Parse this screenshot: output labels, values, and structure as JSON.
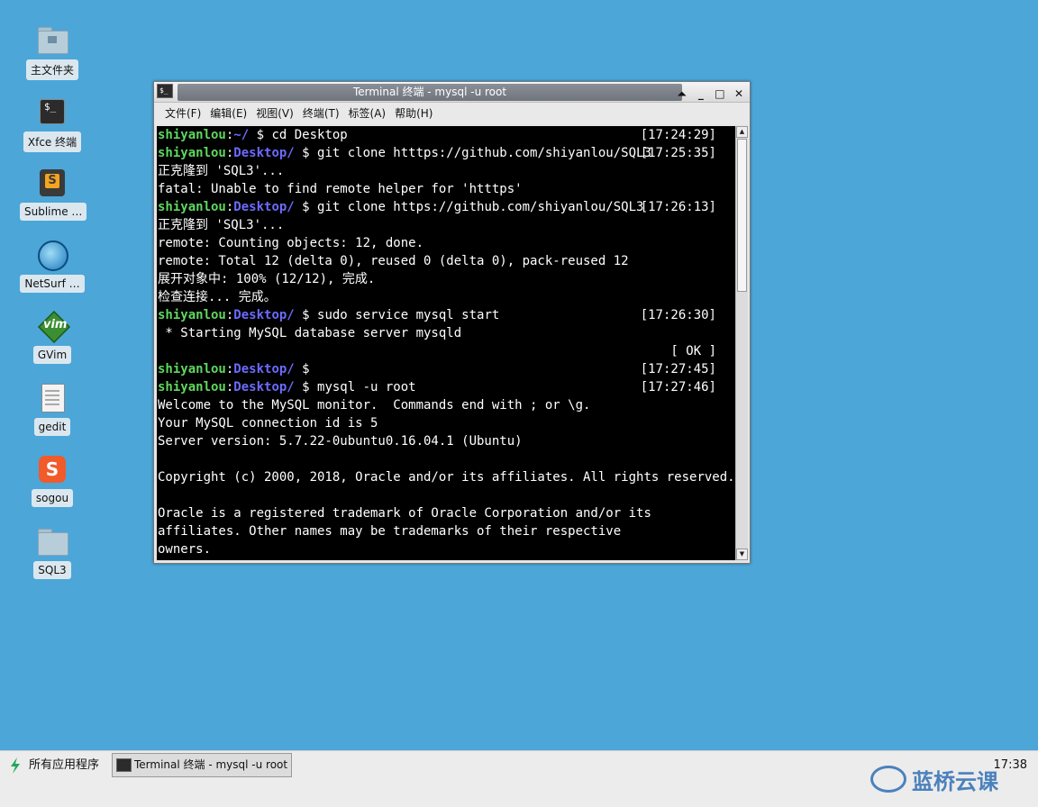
{
  "desktop": {
    "icons": [
      {
        "label": "主文件夹",
        "icon": "home-folder-icon"
      },
      {
        "label": "Xfce 终端",
        "icon": "terminal-icon"
      },
      {
        "label": "Sublime …",
        "icon": "sublime-icon"
      },
      {
        "label": "NetSurf …",
        "icon": "netsurf-icon"
      },
      {
        "label": "GVim",
        "icon": "gvim-icon"
      },
      {
        "label": "gedit",
        "icon": "gedit-icon"
      },
      {
        "label": "sogou",
        "icon": "sogou-icon"
      },
      {
        "label": "SQL3",
        "icon": "folder-icon"
      }
    ]
  },
  "window": {
    "title": "Terminal 终端 - mysql -u root",
    "buttons": {
      "shade": "⏶",
      "minimize": "_",
      "maximize": "□",
      "close": "✕"
    },
    "menu": [
      "文件(F)",
      "编辑(E)",
      "视图(V)",
      "终端(T)",
      "标签(A)",
      "帮助(H)"
    ]
  },
  "terminal": {
    "user": "shiyanlou",
    "lines": [
      {
        "type": "prompt",
        "path": "~/",
        "cmd": " $ cd Desktop",
        "ts": "[17:24:29]"
      },
      {
        "type": "prompt",
        "path": "Desktop/",
        "cmd": " $ git clone htttps://github.com/shiyanlou/SQL3",
        "ts": "[17:25:35]"
      },
      {
        "type": "out",
        "text": "正克隆到 'SQL3'..."
      },
      {
        "type": "out",
        "text": "fatal: Unable to find remote helper for 'htttps'"
      },
      {
        "type": "prompt",
        "path": "Desktop/",
        "cmd": " $ git clone https://github.com/shiyanlou/SQL3",
        "ts": "[17:26:13]"
      },
      {
        "type": "out",
        "text": "正克隆到 'SQL3'..."
      },
      {
        "type": "out",
        "text": "remote: Counting objects: 12, done."
      },
      {
        "type": "out",
        "text": "remote: Total 12 (delta 0), reused 0 (delta 0), pack-reused 12"
      },
      {
        "type": "out",
        "text": "展开对象中: 100% (12/12), 完成."
      },
      {
        "type": "out",
        "text": "检查连接... 完成。"
      },
      {
        "type": "prompt",
        "path": "Desktop/",
        "cmd": " $ sudo service mysql start",
        "ts": "[17:26:30]"
      },
      {
        "type": "out",
        "text": " * Starting MySQL database server mysqld"
      },
      {
        "type": "right",
        "text": "[ OK ]"
      },
      {
        "type": "prompt",
        "path": "Desktop/",
        "cmd": " $",
        "ts": "[17:27:45]"
      },
      {
        "type": "prompt",
        "path": "Desktop/",
        "cmd": " $ mysql -u root",
        "ts": "[17:27:46]"
      },
      {
        "type": "out",
        "text": "Welcome to the MySQL monitor.  Commands end with ; or \\g."
      },
      {
        "type": "out",
        "text": "Your MySQL connection id is 5"
      },
      {
        "type": "out",
        "text": "Server version: 5.7.22-0ubuntu0.16.04.1 (Ubuntu)"
      },
      {
        "type": "out",
        "text": ""
      },
      {
        "type": "out",
        "text": "Copyright (c) 2000, 2018, Oracle and/or its affiliates. All rights reserved."
      },
      {
        "type": "out",
        "text": ""
      },
      {
        "type": "out",
        "text": "Oracle is a registered trademark of Oracle Corporation and/or its"
      },
      {
        "type": "out",
        "text": "affiliates. Other names may be trademarks of their respective"
      },
      {
        "type": "out",
        "text": "owners."
      }
    ]
  },
  "taskbar": {
    "start_label": "所有应用程序",
    "task_label": "Terminal 终端 - mysql -u root",
    "clock": "17:38",
    "watermark": "蓝桥云课"
  },
  "colors": {
    "desktop_bg": "#4ca6d8",
    "prompt_user": "#5fd75f",
    "prompt_path": "#6b6bff"
  }
}
